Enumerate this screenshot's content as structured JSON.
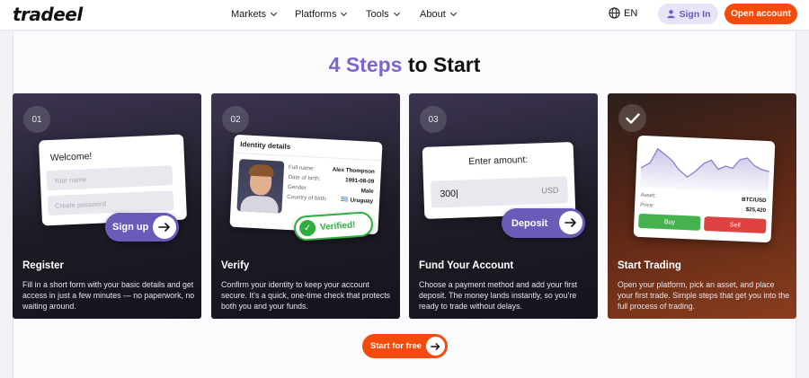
{
  "header": {
    "logo": "tradeel",
    "nav": [
      {
        "label": "Markets"
      },
      {
        "label": "Platforms"
      },
      {
        "label": "Tools"
      },
      {
        "label": "About"
      }
    ],
    "lang": "EN",
    "sign_in": "Sign In",
    "open_account": "Open account"
  },
  "section": {
    "title_accent": "4 Steps",
    "title_rest": "to Start"
  },
  "steps": [
    {
      "number": "01",
      "title": "Register",
      "description": "Fill in a short form with your basic details and get access in just a few minutes — no paperwork, no waiting around.",
      "mock": {
        "welcome": "Welcome!",
        "name_placeholder": "Your name",
        "password_placeholder": "Create password",
        "button": "Sign up"
      }
    },
    {
      "number": "02",
      "title": "Verify",
      "description": "Confirm your identity to keep your account secure. It’s a quick, one-time check that protects both you and your funds.",
      "mock": {
        "heading": "Identity details",
        "fields": [
          {
            "label": "Full name:",
            "value": "Alex Thompson"
          },
          {
            "label": "Date of birth:",
            "value": "1991-08-09"
          },
          {
            "label": "Gender",
            "value": "Male"
          },
          {
            "label": "Country of birth:",
            "value": "Uruguay"
          }
        ],
        "badge": "Verified!"
      }
    },
    {
      "number": "03",
      "title": "Fund Your Account",
      "description": "Choose a payment method and add your first deposit. The money lands instantly, so you’re ready to trade without delays.",
      "mock": {
        "label": "Enter amount:",
        "amount": "300|",
        "currency": "USD",
        "button": "Deposit"
      }
    },
    {
      "title": "Start Trading",
      "description": "Open your platform, pick an asset, and place your first trade. Simple steps that get you into the full process of trading.",
      "mock": {
        "asset_label": "Asset:",
        "asset_value": "BTC/USD",
        "price_label": "Price:",
        "price_value": "$25,420",
        "buy": "Buy",
        "sell": "Sell",
        "chart_color": "#8a7fc8"
      }
    }
  ],
  "cta": "Start for free",
  "colors": {
    "brand_orange": "#f24b0b",
    "accent_purple": "#7d66c9",
    "pill_purple": "#6b5ab8",
    "verified_green": "#2fae3f"
  }
}
